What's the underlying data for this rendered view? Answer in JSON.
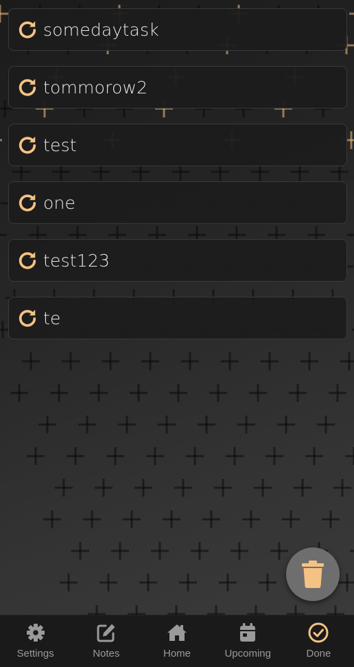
{
  "tasks": [
    {
      "label": "somedaytask",
      "icon": "redo-icon"
    },
    {
      "label": "tommorow2",
      "icon": "redo-icon"
    },
    {
      "label": "test",
      "icon": "redo-icon"
    },
    {
      "label": "one",
      "icon": "redo-icon"
    },
    {
      "label": "test123",
      "icon": "redo-icon"
    },
    {
      "label": "te",
      "icon": "redo-icon"
    }
  ],
  "fab": {
    "icon": "trash-icon"
  },
  "nav": {
    "items": [
      {
        "label": "Settings",
        "icon": "gear-icon"
      },
      {
        "label": "Notes",
        "icon": "edit-icon"
      },
      {
        "label": "Home",
        "icon": "home-icon"
      },
      {
        "label": "Upcoming",
        "icon": "calendar-icon"
      },
      {
        "label": "Done",
        "icon": "check-circle-icon"
      }
    ],
    "active_index": 4
  },
  "colors": {
    "accent": "#f6c283",
    "text": "#e8e8e8",
    "nav_inactive": "#9a9a9a",
    "card": "#1c1c1c",
    "nav_bg": "#1a1a1a"
  }
}
